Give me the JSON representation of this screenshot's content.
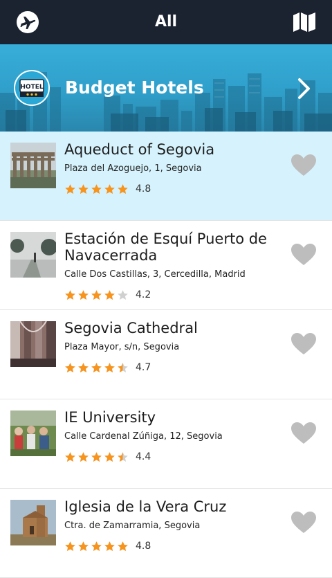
{
  "header": {
    "title": "All",
    "left_icon": "airplane-icon",
    "right_icon": "map-icon"
  },
  "banner": {
    "label": "Budget Hotels",
    "badge_text": "HOTEL",
    "icon": "hotel-badge-icon"
  },
  "colors": {
    "topbar": "#1b2331",
    "banner": "#2f9fca",
    "selected_row": "#d6f3fd",
    "star": "#f7941d",
    "star_empty": "#d0d0d0",
    "heart": "#bdbdbd"
  },
  "places": [
    {
      "name": "Aqueduct of Segovia",
      "address": "Plaza del Azoguejo, 1, Segovia",
      "rating": 4.8,
      "rating_label": "4.8",
      "selected": true
    },
    {
      "name": "Estación de Esquí Puerto de Navacerrada",
      "address": "Calle Dos Castillas, 3, Cercedilla, Madrid",
      "rating": 4.2,
      "rating_label": "4.2",
      "selected": false
    },
    {
      "name": "Segovia Cathedral",
      "address": "Plaza Mayor, s/n, Segovia",
      "rating": 4.7,
      "rating_label": "4.7",
      "selected": false
    },
    {
      "name": "IE University",
      "address": "Calle Cardenal Zúñiga, 12, Segovia",
      "rating": 4.4,
      "rating_label": "4.4",
      "selected": false
    },
    {
      "name": "Iglesia de la Vera Cruz",
      "address": "Ctra. de Zamarramia, Segovia",
      "rating": 4.8,
      "rating_label": "4.8",
      "selected": false
    }
  ]
}
